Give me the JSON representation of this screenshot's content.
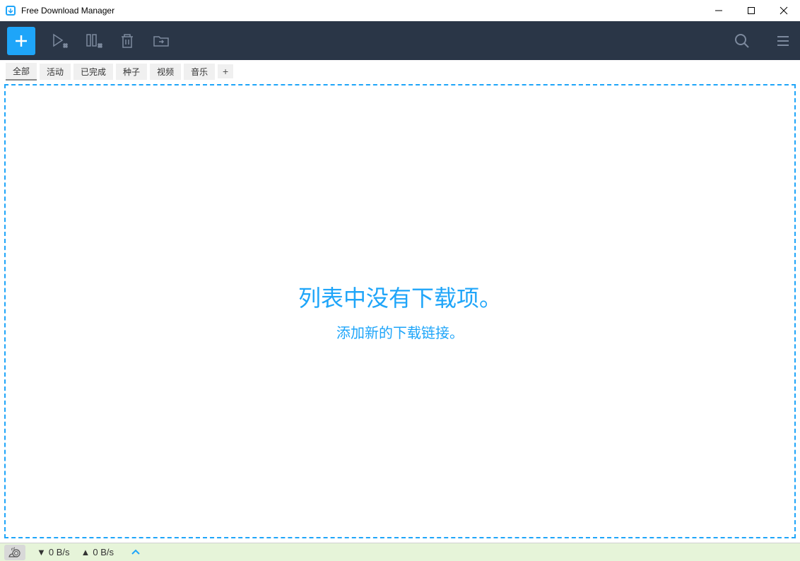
{
  "window": {
    "title": "Free Download Manager"
  },
  "tabs": {
    "all": "全部",
    "active": "活动",
    "completed": "已完成",
    "torrents": "种子",
    "video": "视频",
    "music": "音乐"
  },
  "empty_state": {
    "title": "列表中没有下载项。",
    "add_link": "添加新的下载链接。"
  },
  "status": {
    "download_speed": "0 B/s",
    "upload_speed": "0 B/s"
  }
}
